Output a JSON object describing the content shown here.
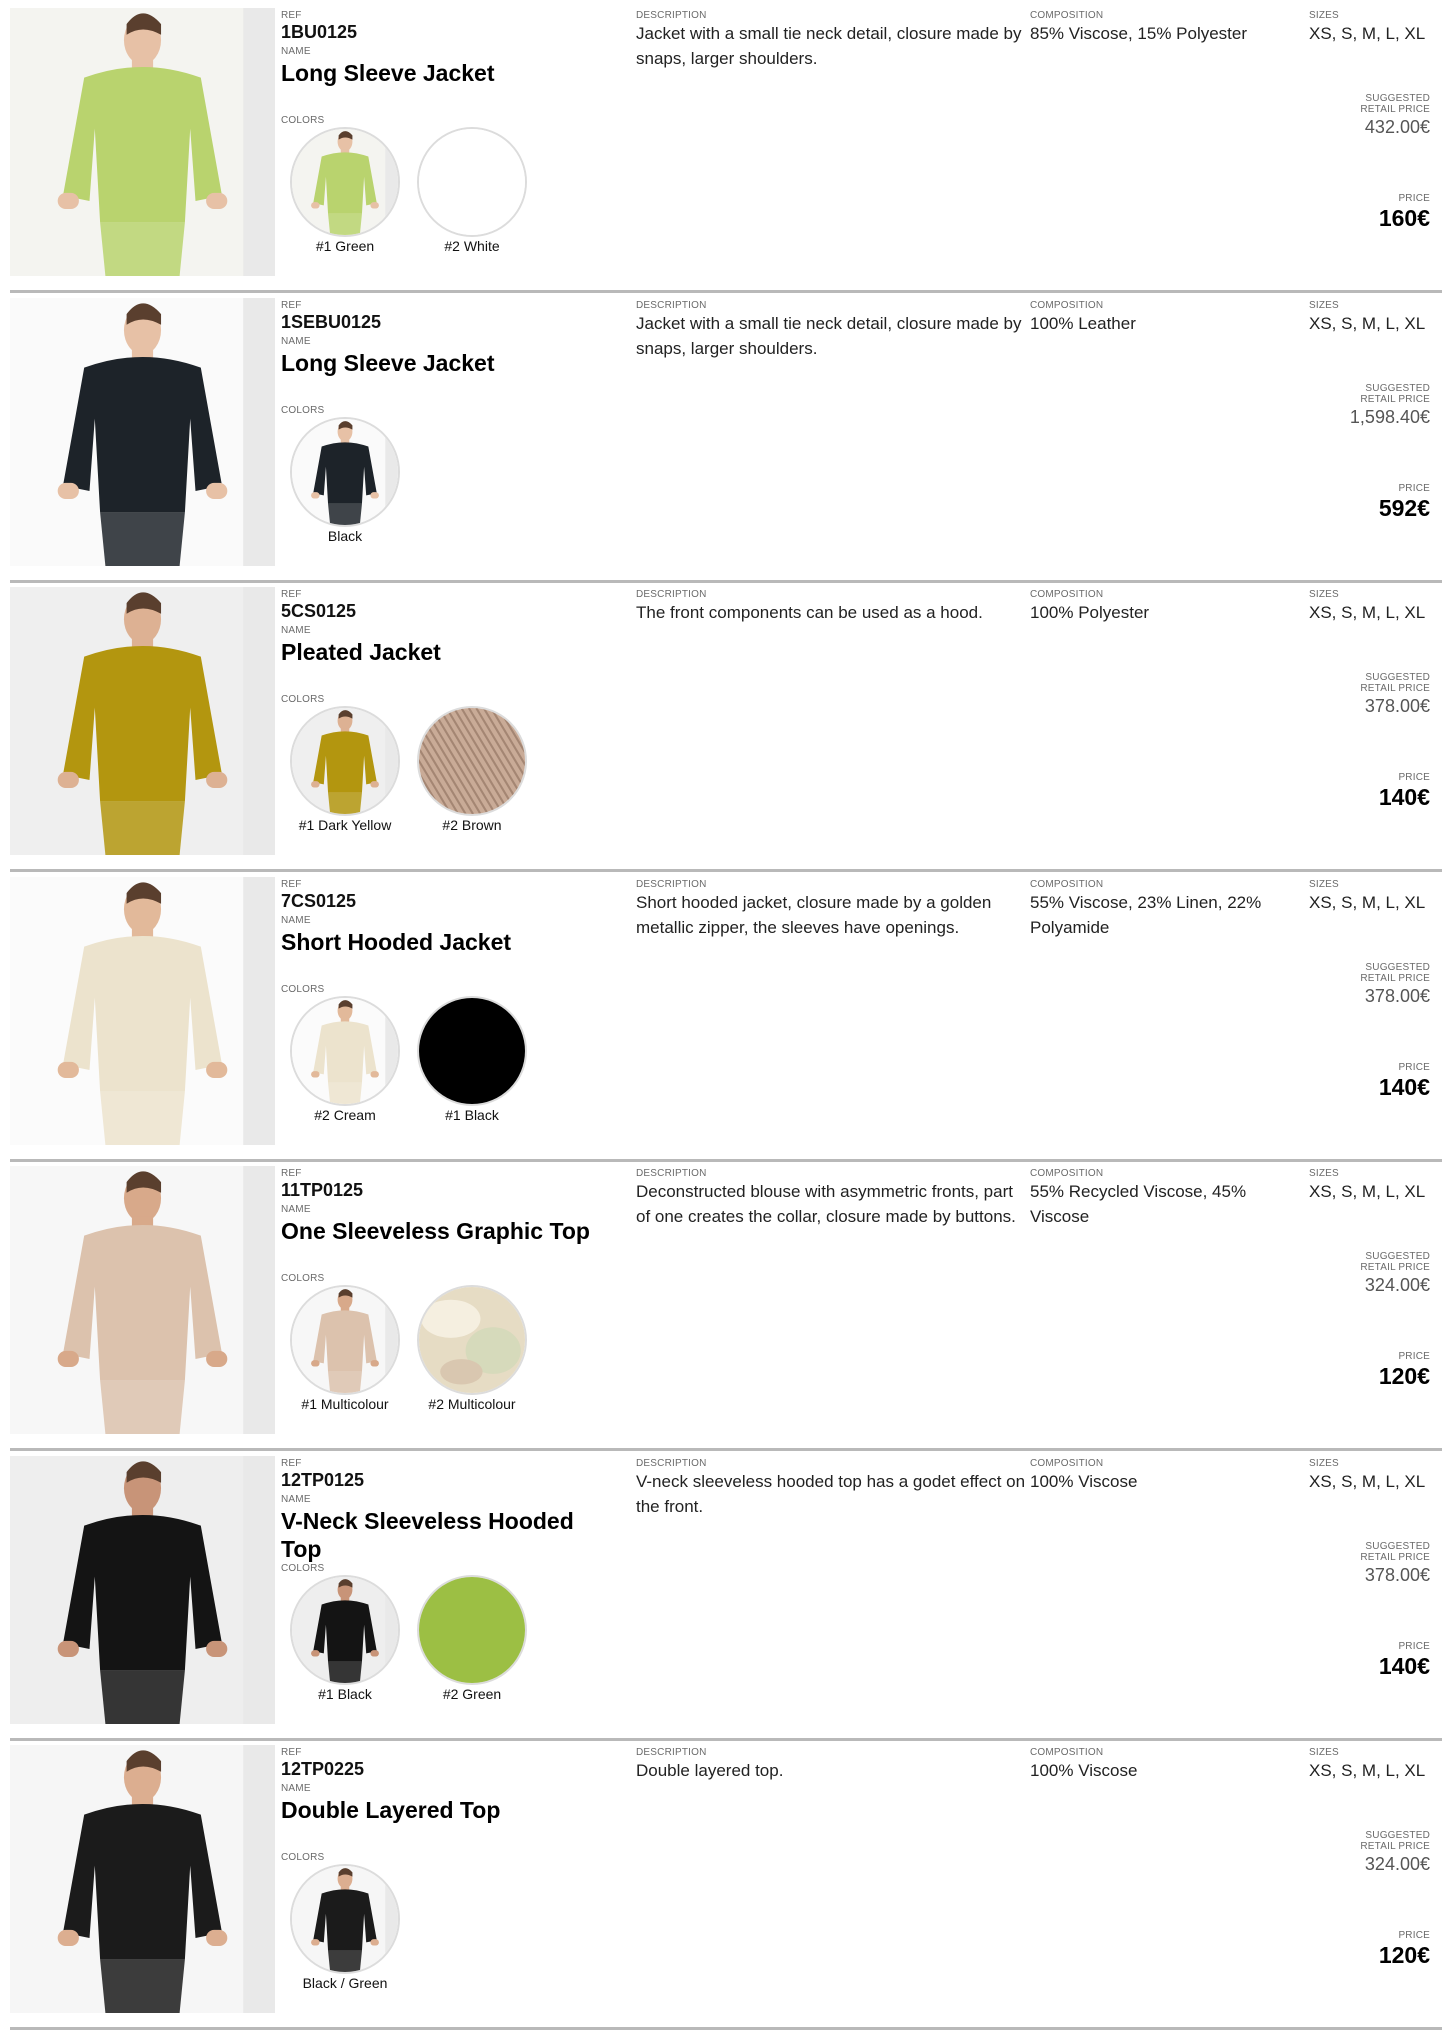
{
  "labels": {
    "ref": "REF",
    "name": "NAME",
    "colors": "COLORS",
    "description": "DESCRIPTION",
    "composition": "COMPOSITION",
    "sizes": "SIZES",
    "srp_line1": "SUGGESTED",
    "srp_line2": "RETAIL PRICE",
    "price": "PRICE"
  },
  "products": [
    {
      "ref": "1BU0125",
      "name": "Long Sleeve Jacket",
      "description": "Jacket with a small tie neck detail, closure made by snaps, larger shoulders.",
      "composition": "85% Viscose, 15% Polyester",
      "sizes": "XS, S, M, L, XL",
      "suggested_retail_price": "432.00€",
      "price": "160€",
      "photo": {
        "garment": "#b9d36e",
        "bg": "#f4f4f0",
        "skin": "#e7c1a6"
      },
      "colors": [
        {
          "label": "#1 Green",
          "kind": "photo",
          "hex": "#b9d36e"
        },
        {
          "label": "#2 White",
          "kind": "flat",
          "hex": "#ffffff"
        }
      ]
    },
    {
      "ref": "1SEBU0125",
      "name": "Long Sleeve Jacket",
      "description": "Jacket with a small tie neck detail, closure made by snaps, larger shoulders.",
      "composition": "100% Leather",
      "sizes": "XS, S, M, L, XL",
      "suggested_retail_price": "1,598.40€",
      "price": "592€",
      "photo": {
        "garment": "#1d2329",
        "bg": "#fafafa",
        "skin": "#e7c1a6"
      },
      "colors": [
        {
          "label": "Black",
          "kind": "photo",
          "hex": "#1d2329"
        }
      ]
    },
    {
      "ref": "5CS0125",
      "name": "Pleated Jacket",
      "description": "The front components can be used as a hood.",
      "composition": "100% Polyester",
      "sizes": "XS, S, M, L, XL",
      "suggested_retail_price": "378.00€",
      "price": "140€",
      "photo": {
        "garment": "#b3960f",
        "bg": "#efefef",
        "skin": "#ddb193"
      },
      "colors": [
        {
          "label": "#1 Dark Yellow",
          "kind": "photo",
          "hex": "#b3960f"
        },
        {
          "label": "#2 Brown",
          "kind": "pleat",
          "hex": "#c9ab97"
        }
      ]
    },
    {
      "ref": "7CS0125",
      "name": "Short Hooded Jacket",
      "description": "Short hooded jacket, closure made by a golden metallic zipper, the sleeves have openings.",
      "composition": "55% Viscose, 23% Linen, 22% Polyamide",
      "sizes": "XS, S, M, L, XL",
      "suggested_retail_price": "378.00€",
      "price": "140€",
      "photo": {
        "garment": "#ece3cd",
        "bg": "#fbfbfb",
        "skin": "#e2b99a"
      },
      "colors": [
        {
          "label": "#2 Cream",
          "kind": "photo",
          "hex": "#ece3cd"
        },
        {
          "label": "#1 Black",
          "kind": "flat",
          "hex": "#000000"
        }
      ]
    },
    {
      "ref": "11TP0125",
      "name": "One Sleeveless Graphic Top",
      "description": "Deconstructed blouse with asymmetric fronts, part of one creates the collar, closure made by buttons.",
      "composition": "55% Recycled Viscose, 45% Viscose",
      "sizes": "XS, S, M, L, XL",
      "suggested_retail_price": "324.00€",
      "price": "120€",
      "photo": {
        "garment": "#dcc2ad",
        "bg": "#f7f7f7",
        "skin": "#d8a98a"
      },
      "colors": [
        {
          "label": "#1 Multicolour",
          "kind": "photo",
          "hex": "#dcc2ad"
        },
        {
          "label": "#2 Multicolour",
          "kind": "marble",
          "hex": "#e6dcc4"
        }
      ]
    },
    {
      "ref": "12TP0125",
      "name": "V-Neck Sleeveless Hooded Top",
      "description": "V-neck sleeveless hooded top has a godet effect on the front.",
      "composition": "100% Viscose",
      "sizes": "XS, S, M, L, XL",
      "suggested_retail_price": "378.00€",
      "price": "140€",
      "photo": {
        "garment": "#141414",
        "bg": "#eeeeee",
        "skin": "#c89478"
      },
      "colors": [
        {
          "label": "#1 Black",
          "kind": "photo",
          "hex": "#141414"
        },
        {
          "label": "#2 Green",
          "kind": "flat",
          "hex": "#9cbf44"
        }
      ]
    },
    {
      "ref": "12TP0225",
      "name": "Double Layered Top",
      "description": "Double layered top.",
      "composition": "100% Viscose",
      "sizes": "XS, S, M, L, XL",
      "suggested_retail_price": "324.00€",
      "price": "120€",
      "photo": {
        "garment": "#1b1b1b",
        "bg": "#f6f6f6",
        "skin": "#dcae90"
      },
      "colors": [
        {
          "label": "Black / Green",
          "kind": "photo",
          "hex": "#1b1b1b"
        }
      ]
    }
  ]
}
